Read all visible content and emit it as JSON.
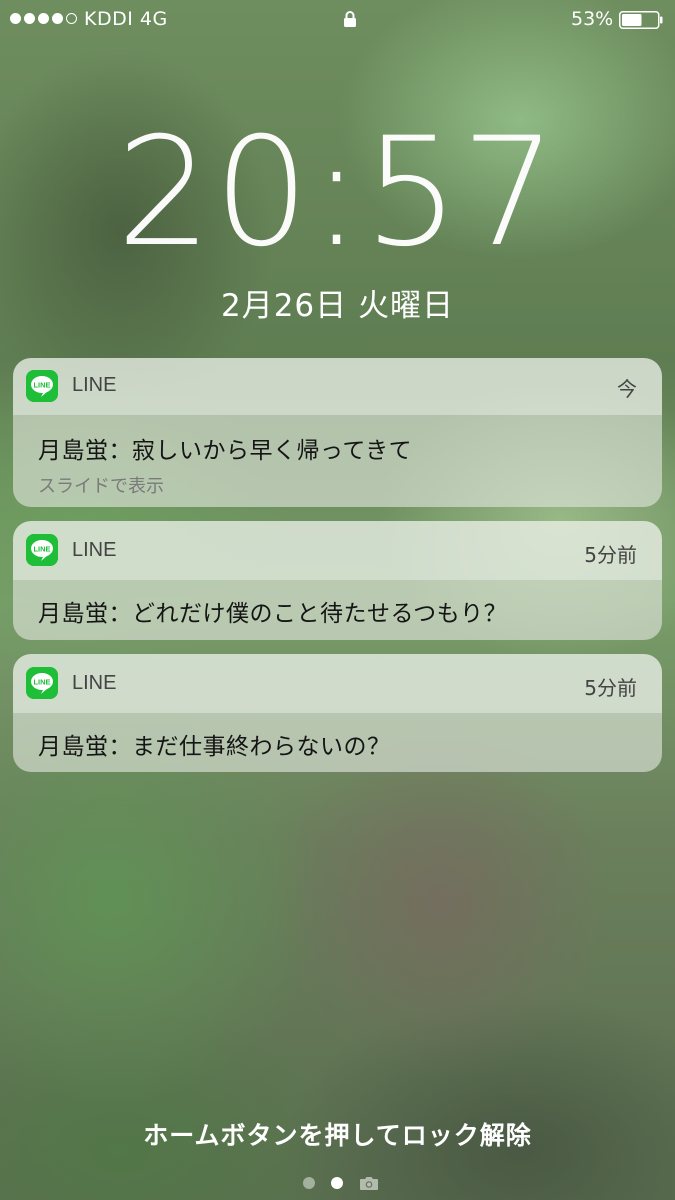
{
  "status_bar": {
    "carrier": "KDDI 4G",
    "signal_bars": 4,
    "signal_max": 5,
    "battery_percent": "53%",
    "battery_level": 0.53,
    "lock_icon": "lock-icon"
  },
  "lockscreen": {
    "time": "20:57",
    "date": "2月26日 火曜日"
  },
  "notifications": [
    {
      "app": "LINE",
      "app_icon_text": "LINE",
      "time": "今",
      "message": "月島蛍：寂しいから早く帰ってきて",
      "hint": "スライドで表示"
    },
    {
      "app": "LINE",
      "app_icon_text": "LINE",
      "time": "5分前",
      "message": "月島蛍：どれだけ僕のこと待たせるつもり？"
    },
    {
      "app": "LINE",
      "app_icon_text": "LINE",
      "time": "5分前",
      "message": "月島蛍：まだ仕事終わらないの？"
    }
  ],
  "bottom": {
    "unlock_hint": "ホームボタンを押してロック解除",
    "pages": 2,
    "current_page": 2,
    "camera_icon": "camera-icon"
  },
  "colors": {
    "line_green": "#1fbe38"
  }
}
